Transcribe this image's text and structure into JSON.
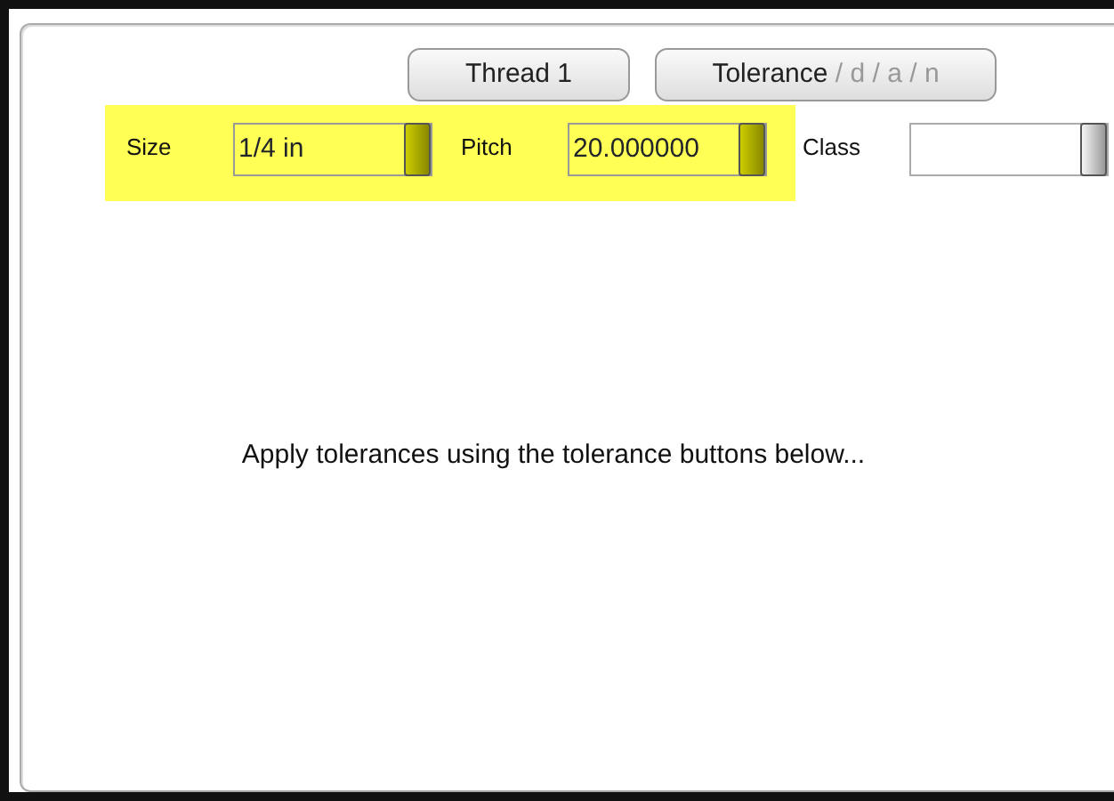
{
  "buttons": [
    {
      "label": "Thread 1"
    },
    {
      "label": "Tolerance",
      "suffix": " / d / a / n",
      "suffix_dimmed": true
    }
  ],
  "fields": [
    {
      "label": "Size",
      "value": "1/4 in",
      "highlighted": true
    },
    {
      "label": "Pitch",
      "value": "20.000000",
      "highlighted": true
    },
    {
      "label": "Class",
      "highlighted": false
    }
  ],
  "message": "Apply tolerances using the tolerance buttons below..."
}
